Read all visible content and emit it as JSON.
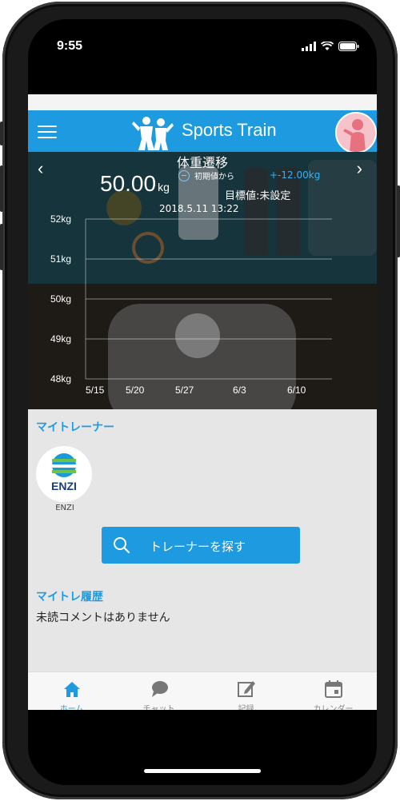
{
  "status": {
    "time": "9:55"
  },
  "header": {
    "app_name": "Sports Train"
  },
  "weight": {
    "title": "体重遷移",
    "current": "50.00",
    "unit": "kg",
    "initial_label": "初期値から",
    "diff": "+-12.00kg",
    "target": "目標値:未設定",
    "datetime": "2018.5.11  13:22",
    "prev_arrow": "‹",
    "next_arrow": "›"
  },
  "chart_data": {
    "type": "line",
    "x_tick_labels": [
      "5/15",
      "5/20",
      "5/27",
      "6/3",
      "6/10"
    ],
    "y_tick_labels": [
      "48kg",
      "49kg",
      "50kg",
      "51kg",
      "52kg"
    ],
    "ylim": [
      48,
      52
    ],
    "series": [],
    "grid": true
  },
  "trainer_section": {
    "title": "マイトレーナー",
    "trainer_name": "ENZI",
    "logo_text": "ENZI"
  },
  "search_button": {
    "label": "トレーナーを探す",
    "icon": "search-icon"
  },
  "history": {
    "title": "マイトレ履歴",
    "message": "未読コメントはありません"
  },
  "tabs": [
    {
      "label": "ホーム",
      "icon": "home-icon",
      "active": true
    },
    {
      "label": "チャット",
      "icon": "chat-icon",
      "active": false
    },
    {
      "label": "記録",
      "icon": "edit-icon",
      "active": false
    },
    {
      "label": "カレンダー",
      "icon": "calendar-icon",
      "active": false
    }
  ],
  "colors": {
    "accent": "#1e9be0",
    "header": "#1e9be0",
    "background": "#e6e6e6"
  }
}
